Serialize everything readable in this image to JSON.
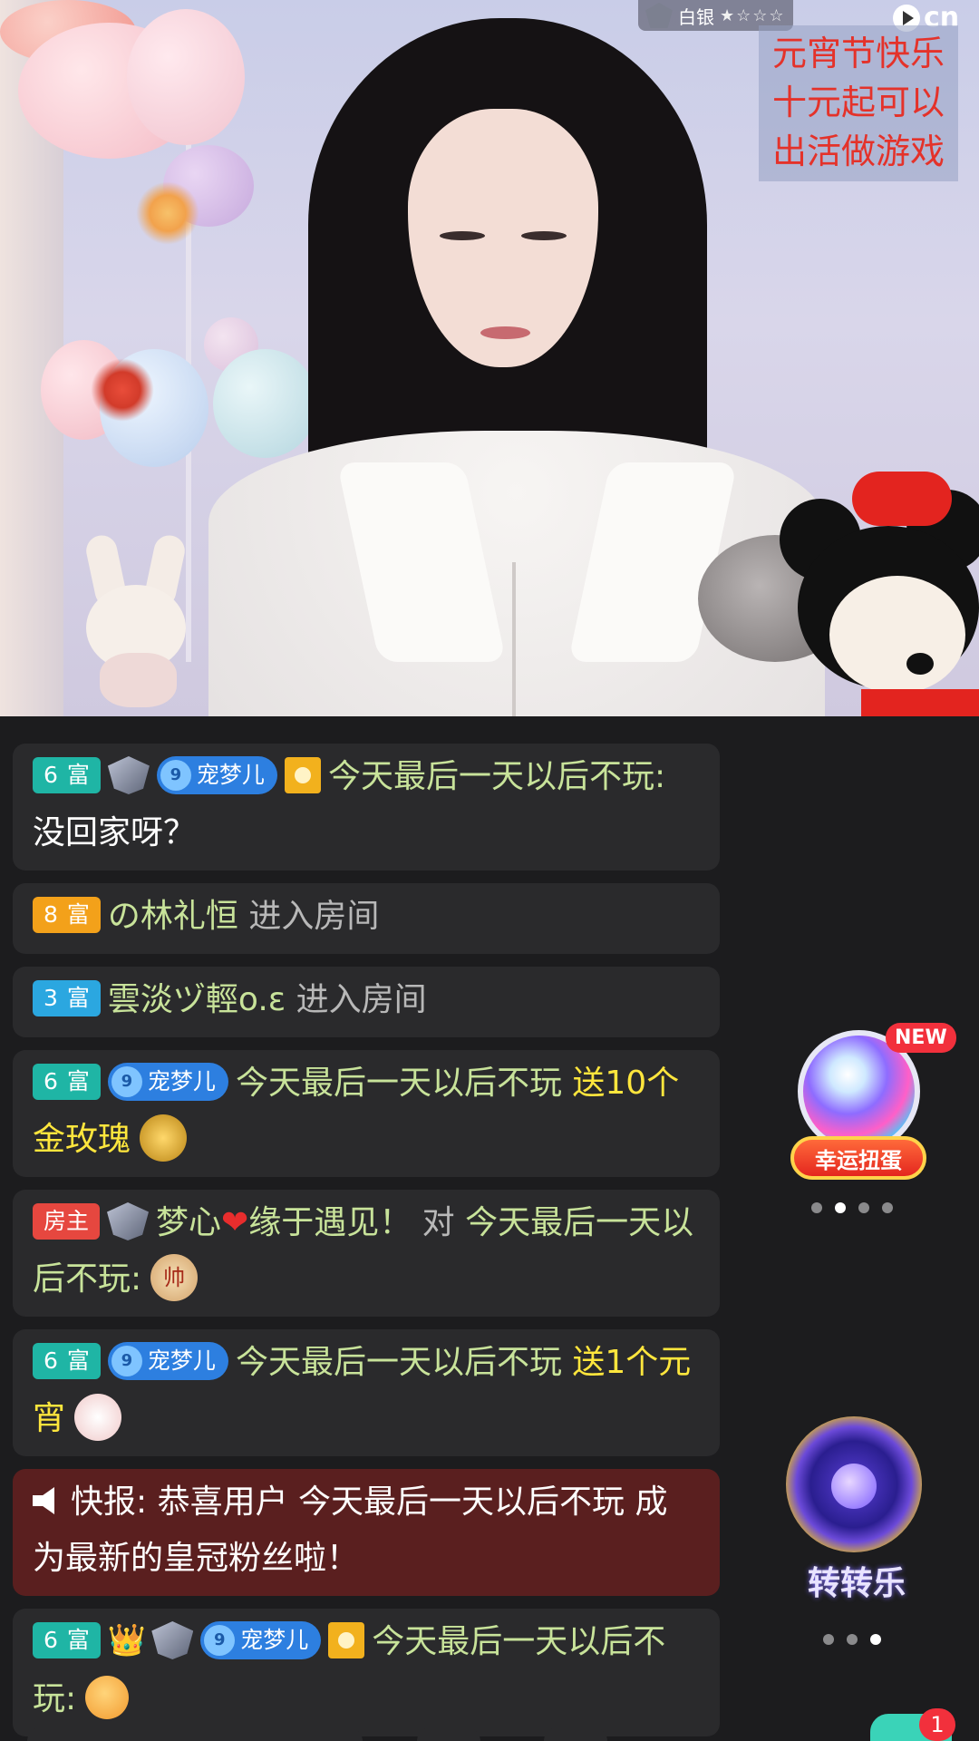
{
  "overlay": {
    "rank_label": "白银",
    "stars": "★☆☆☆",
    "logo_text": "cn",
    "notice_lines": [
      "元宵节快乐",
      "十元起可以",
      "出活做游戏"
    ]
  },
  "chat": [
    {
      "level": "6",
      "level_label": "富",
      "fan_name": "宠梦儿",
      "fan_level": "9",
      "user": "今天最后一天以后不玩:",
      "text": "没回家呀？"
    },
    {
      "level": "8",
      "level_label": "富",
      "user": "の林礼恒",
      "text": "进入房间"
    },
    {
      "level": "3",
      "level_label": "富",
      "user": "雲淡ヅ輕o.ε",
      "text": "进入房间"
    },
    {
      "level": "6",
      "level_label": "富",
      "fan_name": "宠梦儿",
      "fan_level": "9",
      "user": "今天最后一天以后不玩",
      "gift_text": "送10个金玫瑰"
    },
    {
      "badge": "房主",
      "user": "梦心",
      "heart": "❤",
      "user_suffix": "缘于遇见！",
      "text_gray": "对",
      "user2": "今天最后一天以后不玩:",
      "coin": "帅"
    },
    {
      "level": "6",
      "level_label": "富",
      "fan_name": "宠梦儿",
      "fan_level": "9",
      "user": "今天最后一天以后不玩",
      "gift_text": "送1个元宵"
    },
    {
      "alert": "快报: 恭喜用户 今天最后一天以后不玩 成为最新的皇冠粉丝啦！"
    },
    {
      "level": "6",
      "level_label": "富",
      "fan_name": "宠梦儿",
      "fan_level": "9",
      "crown": "👑",
      "user": "今天最后一天以后不玩:"
    }
  ],
  "widgets": {
    "gacha_new": "NEW",
    "gacha_label": "幸运扭蛋",
    "wheel_label": "转转乐",
    "unread_count": "1"
  },
  "colors": {
    "chat_bg": "#2a2a2c",
    "username": "#c8e39a",
    "gift_text": "#ffe63d",
    "alert_bg": "#5a1f1f"
  }
}
